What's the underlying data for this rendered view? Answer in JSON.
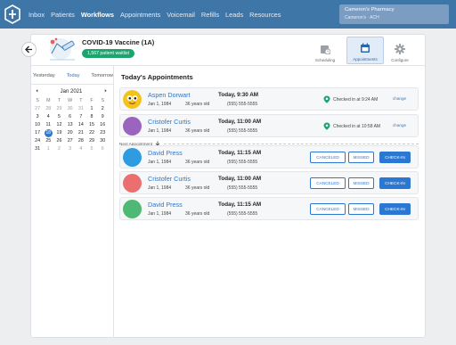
{
  "nav": {
    "items": [
      {
        "label": "Inbox",
        "active": false
      },
      {
        "label": "Patients",
        "active": false
      },
      {
        "label": "Workflows",
        "active": true
      },
      {
        "label": "Appointments",
        "active": false
      },
      {
        "label": "Voicemail",
        "active": false
      },
      {
        "label": "Refills",
        "active": false
      },
      {
        "label": "Leads",
        "active": false
      },
      {
        "label": "Resources",
        "active": false
      }
    ],
    "pharmacy_name": "Cameron's Pharmacy",
    "pharmacy_location": "Cameron's · ACH"
  },
  "header": {
    "title": "COVID-19 Vaccine (1A)",
    "waitlist": "1,567 patient waitlist",
    "tools": [
      {
        "label": "Scheduling",
        "icon": "clock-calendar-icon",
        "selected": false
      },
      {
        "label": "Appointments",
        "icon": "calendar-icon",
        "selected": true
      },
      {
        "label": "Configure",
        "icon": "gear-icon",
        "selected": false
      }
    ]
  },
  "calendar": {
    "quick": [
      "Yesterday",
      "Today",
      "Tomorrow"
    ],
    "month": "Jan 2021",
    "dow": [
      "S",
      "M",
      "T",
      "W",
      "T",
      "F",
      "S"
    ],
    "weeks": [
      [
        "27",
        "28",
        "29",
        "30",
        "31",
        "1",
        "2"
      ],
      [
        "3",
        "4",
        "5",
        "6",
        "7",
        "8",
        "9"
      ],
      [
        "10",
        "11",
        "12",
        "13",
        "14",
        "15",
        "16"
      ],
      [
        "17",
        "18",
        "19",
        "20",
        "21",
        "22",
        "23"
      ],
      [
        "24",
        "25",
        "26",
        "27",
        "28",
        "29",
        "30"
      ],
      [
        "31",
        "1",
        "2",
        "3",
        "4",
        "5",
        "6"
      ]
    ],
    "selected_day": "18"
  },
  "appointments": {
    "title": "Today's Appointments",
    "divider_label": "Next Appointment",
    "change_label": "change",
    "canceled_label": "CANCELED",
    "missed_label": "MISSED",
    "checkin_label": "CHECK-IN",
    "items": [
      {
        "name": "Aspen Dorwart",
        "dob": "Jan 1, 1984",
        "age": "36 years old",
        "time": "Today, 9:30 AM",
        "phone": "(555) 555-5555",
        "status": "Checked in at 9:24 AM",
        "avatar": "#f5c21b"
      },
      {
        "name": "Cristofer Curtis",
        "dob": "Jan 1, 1984",
        "age": "36 years old",
        "time": "Today, 11:00 AM",
        "phone": "(555) 555-5555",
        "status": "Checked in at 10:58 AM",
        "avatar": "#9b64c0"
      },
      {
        "name": "David Press",
        "dob": "Jan 1, 1984",
        "age": "36 years old",
        "time": "Today, 11:15 AM",
        "phone": "(555) 555-5555",
        "status": "",
        "avatar": "#2f9be0"
      },
      {
        "name": "Cristofer Curtis",
        "dob": "Jan 1, 1984",
        "age": "36 years old",
        "time": "Today, 11:00 AM",
        "phone": "(555) 555-5555",
        "status": "",
        "avatar": "#eb6f6f"
      },
      {
        "name": "David Press",
        "dob": "Jan 1, 1984",
        "age": "36 years old",
        "time": "Today, 11:15 AM",
        "phone": "(555) 555-5555",
        "status": "",
        "avatar": "#4fb874"
      }
    ]
  },
  "colors": {
    "nav_bg": "#3f76a8",
    "accent": "#2a78d2",
    "waitlist": "#1aa56e",
    "checkin_pin": "#1aa56e"
  }
}
